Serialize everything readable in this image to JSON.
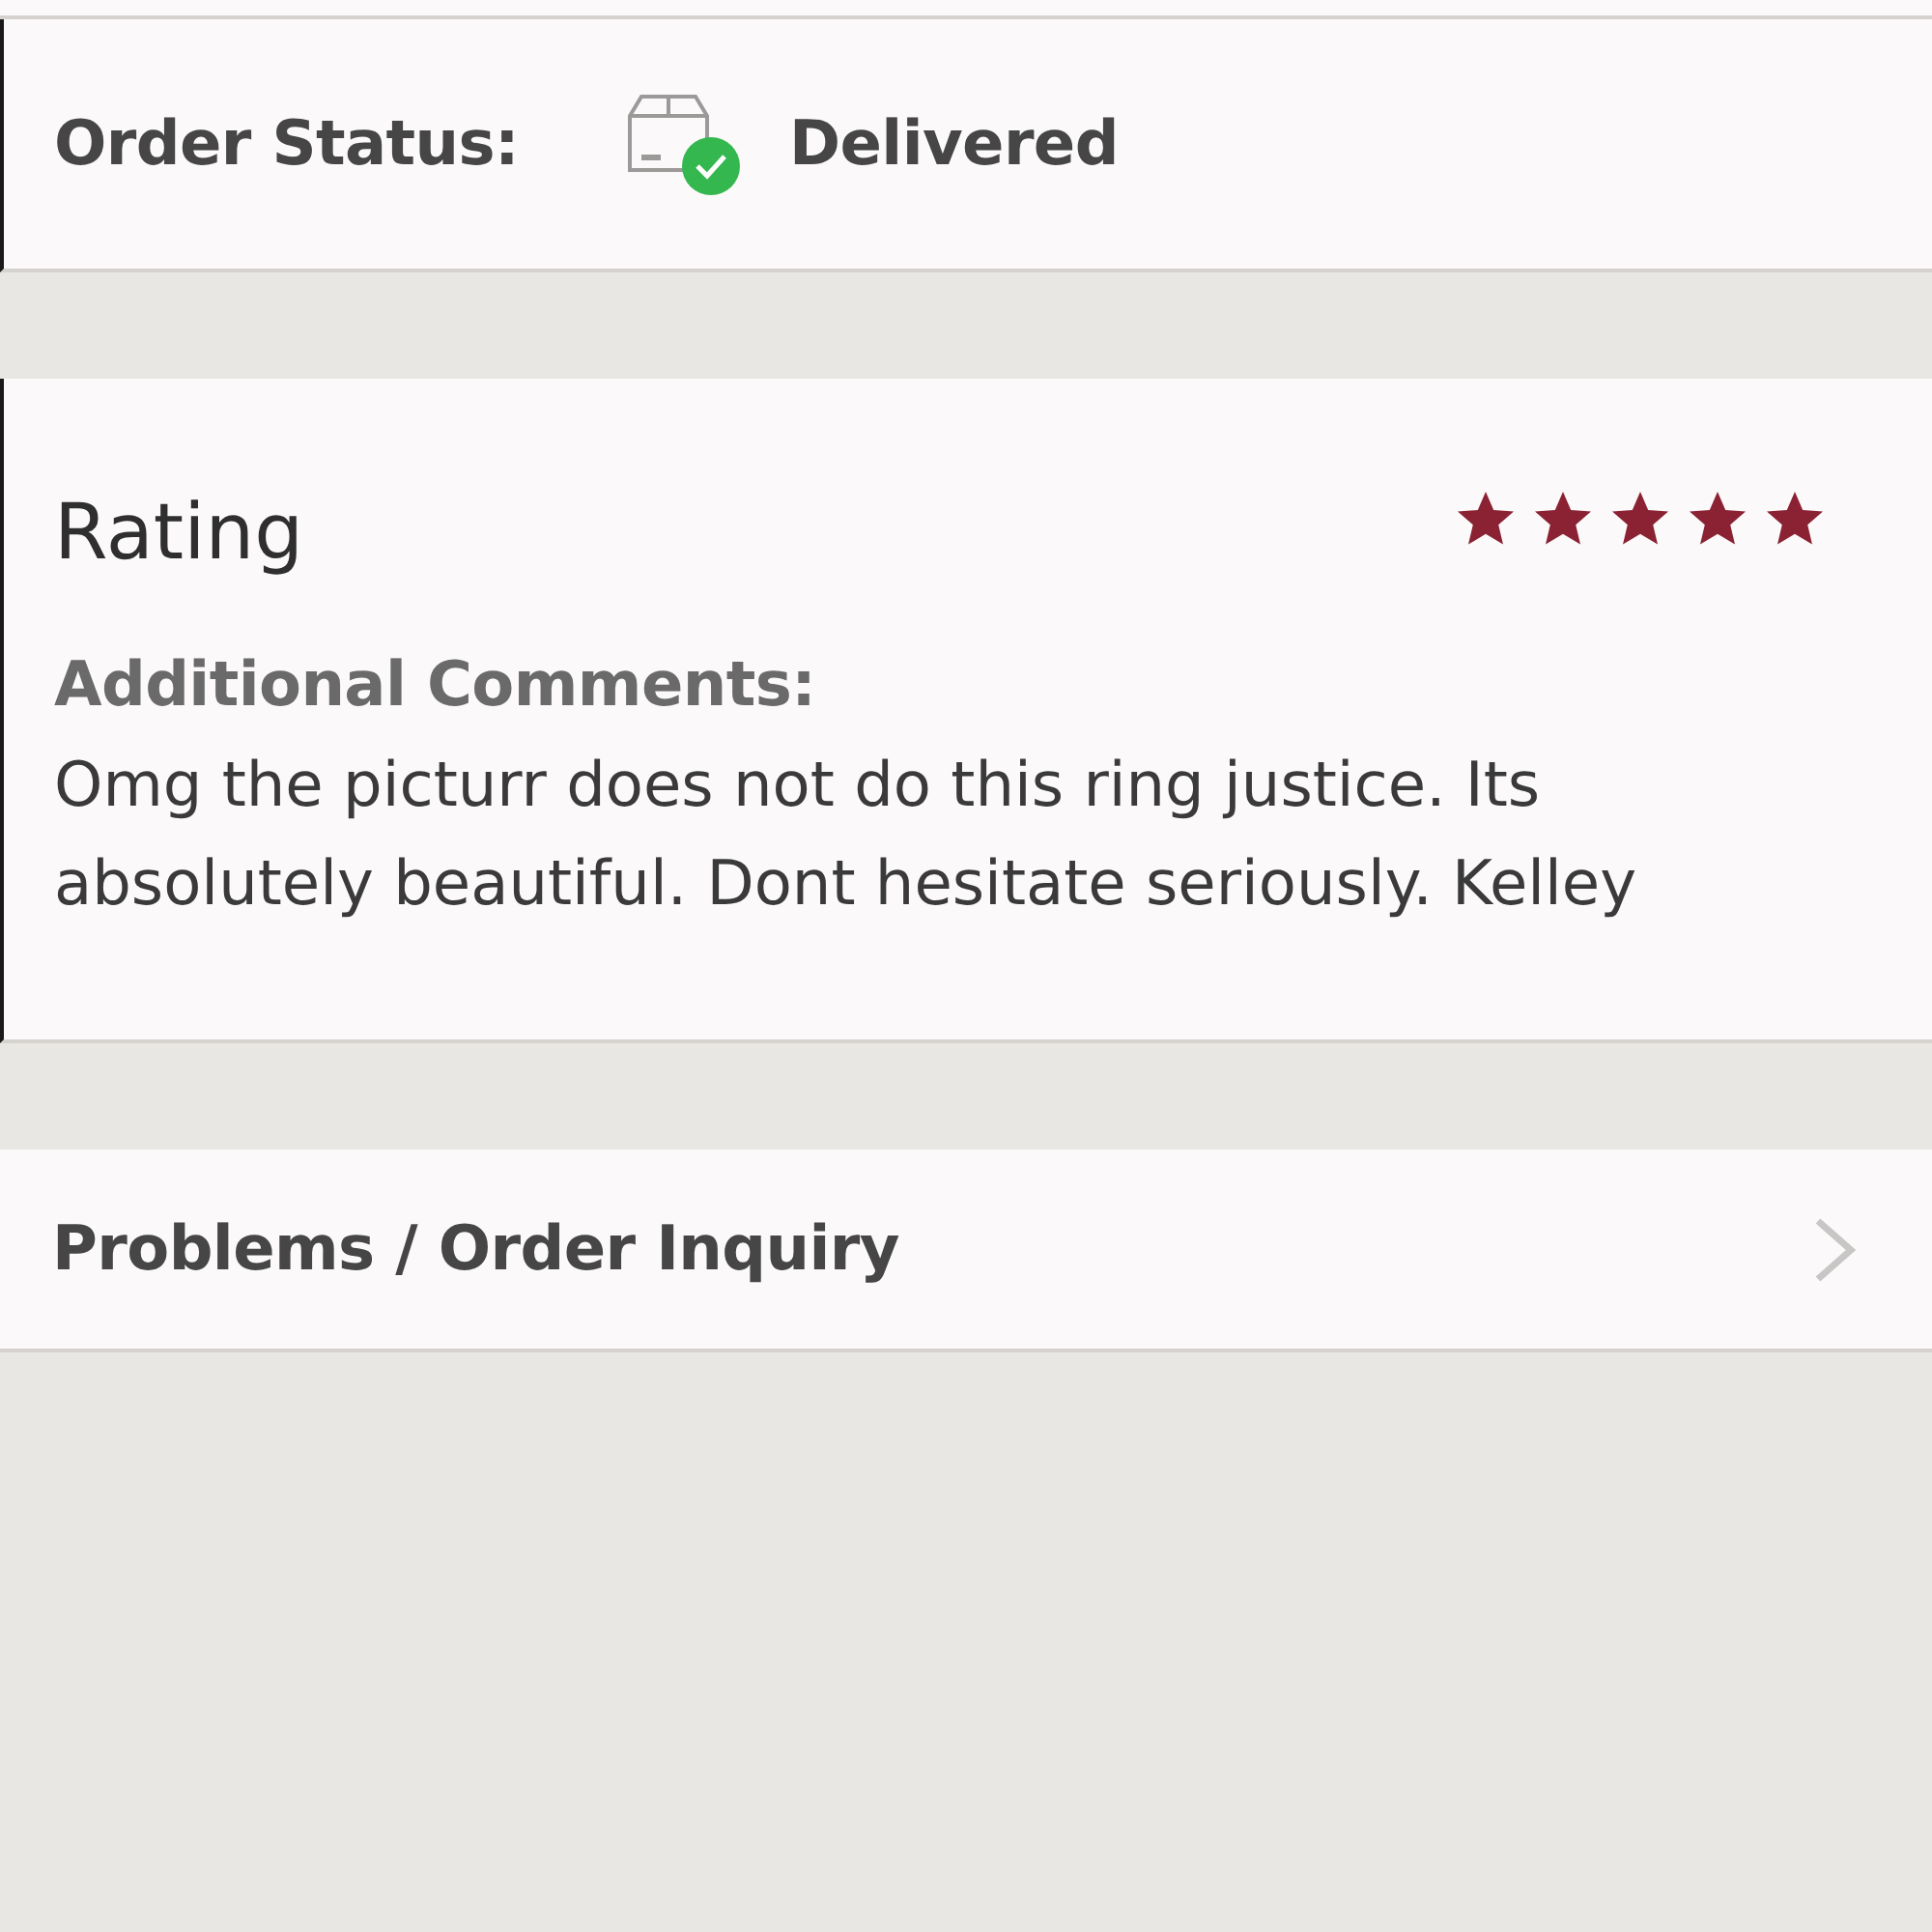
{
  "order_status": {
    "label": "Order Status:",
    "value": "Delivered"
  },
  "rating": {
    "label": "Rating",
    "stars": 5,
    "comments_label": "Additional Comments:",
    "comments": "Omg the picturr does not do this ring justice. Its absolutely beautiful. Dont hesitate seriously. Kelley"
  },
  "inquiry": {
    "label": "Problems / Order Inquiry"
  }
}
